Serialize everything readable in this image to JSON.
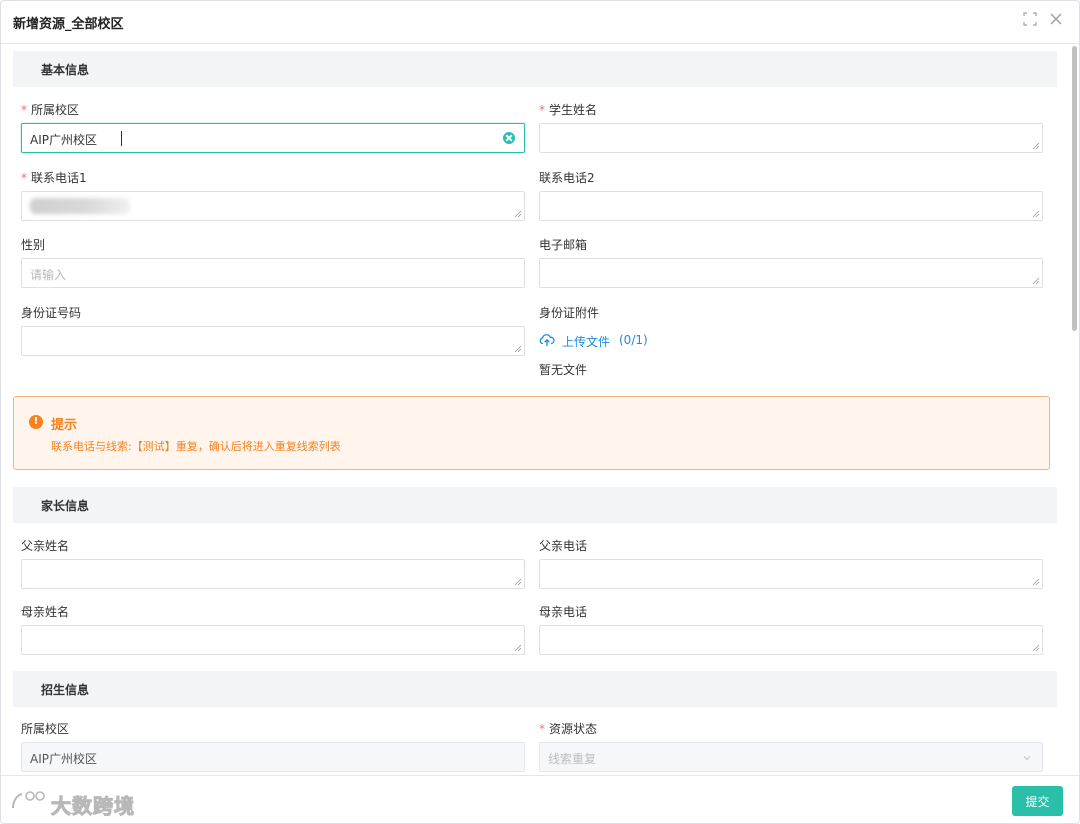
{
  "dialog": {
    "title": "新增资源_全部校区",
    "fullscreen_icon": "⛶",
    "close_icon": "✕"
  },
  "sections": {
    "basic": "基本信息",
    "parents": "家长信息",
    "admission": "招生信息"
  },
  "basic": {
    "campus": {
      "label": "所属校区",
      "value": "AIP广州校区"
    },
    "student_name": {
      "label": "学生姓名",
      "value": ""
    },
    "phone1": {
      "label": "联系电话1"
    },
    "phone2": {
      "label": "联系电话2",
      "value": ""
    },
    "gender": {
      "label": "性别",
      "placeholder": "请输入"
    },
    "email": {
      "label": "电子邮箱",
      "value": ""
    },
    "id_number": {
      "label": "身份证号码",
      "value": ""
    },
    "id_attachment": {
      "label": "身份证附件",
      "upload_label": "上传文件",
      "upload_count": "(0/1)",
      "empty_text": "暂无文件"
    }
  },
  "alert": {
    "title": "提示",
    "message": "联系电话与线索:【测试】重复，确认后将进入重复线索列表",
    "icon": "!"
  },
  "parents": {
    "father_name": {
      "label": "父亲姓名"
    },
    "father_phone": {
      "label": "父亲电话"
    },
    "mother_name": {
      "label": "母亲姓名"
    },
    "mother_phone": {
      "label": "母亲电话"
    }
  },
  "admission": {
    "campus": {
      "label": "所属校区",
      "value": "AIP广州校区"
    },
    "status": {
      "label": "资源状态",
      "placeholder": "线索重复"
    }
  },
  "footer": {
    "submit_label": "提交",
    "watermark": "大数跨境"
  },
  "colors": {
    "accent": "#27bfb0",
    "warning": "#f5821f",
    "required": "#f56c6c",
    "link": "#1d8ce0"
  }
}
